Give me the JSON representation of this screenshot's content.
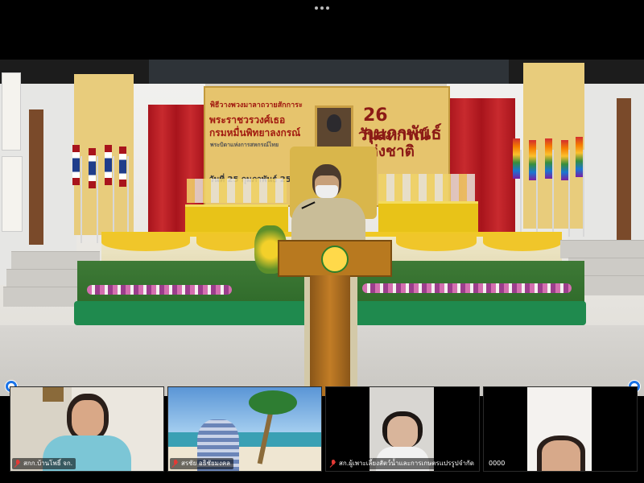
{
  "top_bar": {
    "more_icon": "more-horizontal-icon"
  },
  "main_video": {
    "banner": {
      "line1": "พิธีวางพวงมาลาถวายสักการะ",
      "line2": "พระราชวรวงศ์เธอ",
      "line3": "กรมหมื่นพิทยาลงกรณ์",
      "line4": "พระบิดาแห่งการสหกรณ์ไทย",
      "number": "26 กุมภาพันธ์",
      "big": "วันสหกรณ์แห่งชาติ",
      "date": "วันที่ 25 กุมภาพันธ์ 2565"
    }
  },
  "participants": [
    {
      "label": "สกก.บ้านโพธิ์ จก.",
      "muted": true,
      "mic_icon": "mic-off-icon"
    },
    {
      "label": "สรชัย อธิชัยมงคล",
      "muted": true,
      "mic_icon": "mic-off-icon"
    },
    {
      "label": "สก.ผู้เพาะเลี้ยงสัตว์น้ำและการเกษตรแปรรูปจำกัด",
      "muted": true,
      "mic_icon": "mic-off-icon"
    },
    {
      "label": "0000",
      "muted": false,
      "mic_icon": ""
    }
  ],
  "colors": {
    "accent": "#1a73e8",
    "muted_red": "#e53935",
    "background": "#000000"
  }
}
